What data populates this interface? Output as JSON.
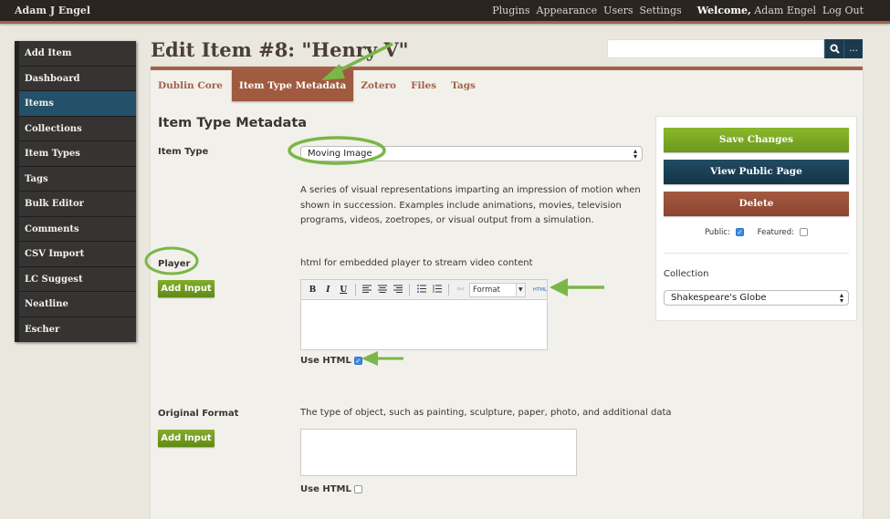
{
  "topbar": {
    "site_name": "Adam J Engel",
    "nav": [
      "Plugins",
      "Appearance",
      "Users",
      "Settings"
    ],
    "welcome_prefix": "Welcome,",
    "welcome_user": "Adam Engel",
    "logout": "Log Out"
  },
  "sidebar": {
    "items": [
      {
        "label": "Add Item"
      },
      {
        "label": "Dashboard"
      },
      {
        "label": "Items",
        "active": true
      },
      {
        "label": "Collections"
      },
      {
        "label": "Item Types"
      },
      {
        "label": "Tags"
      },
      {
        "label": "Bulk Editor"
      },
      {
        "label": "Comments"
      },
      {
        "label": "CSV Import"
      },
      {
        "label": "LC Suggest"
      },
      {
        "label": "Neatline"
      },
      {
        "label": "Escher"
      }
    ]
  },
  "page": {
    "title": "Edit Item #8: \"Henry V\""
  },
  "search": {
    "value": "",
    "search_icon": "search-icon",
    "advanced_label": "..."
  },
  "tabs": [
    {
      "label": "Dublin Core"
    },
    {
      "label": "Item Type Metadata",
      "active": true
    },
    {
      "label": "Zotero"
    },
    {
      "label": "Files"
    },
    {
      "label": "Tags"
    }
  ],
  "main": {
    "section_title": "Item Type Metadata",
    "item_type": {
      "label": "Item Type",
      "selected": "Moving Image",
      "description": "A series of visual representations imparting an impression of motion when shown in succession. Examples include animations, movies, television programs, videos, zoetropes, or visual output from a simulation."
    },
    "player": {
      "label": "Player",
      "add_input": "Add Input",
      "description": "html for embedded player to stream video content",
      "editor": {
        "bold": "B",
        "italic": "I",
        "underline": "U",
        "format_placeholder": "Format",
        "html_label": "HTML",
        "content": ""
      },
      "use_html_label": "Use HTML",
      "use_html_checked": true
    },
    "original_format": {
      "label": "Original Format",
      "add_input": "Add Input",
      "description": "The type of object, such as painting, sculpture, paper, photo, and additional data",
      "value": "",
      "use_html_label": "Use HTML",
      "use_html_checked": false
    }
  },
  "side_panel": {
    "save": "Save Changes",
    "view_public": "View Public Page",
    "delete": "Delete",
    "public_label": "Public:",
    "public_checked": true,
    "featured_label": "Featured:",
    "featured_checked": false,
    "collection_label": "Collection",
    "collection_selected": "Shakespeare's Globe"
  },
  "colors": {
    "accent": "#a3614a",
    "active_nav": "#245069",
    "save": "#7aa824",
    "view": "#1c3f55",
    "delete": "#9a4f38",
    "annotation": "#7ab648"
  }
}
